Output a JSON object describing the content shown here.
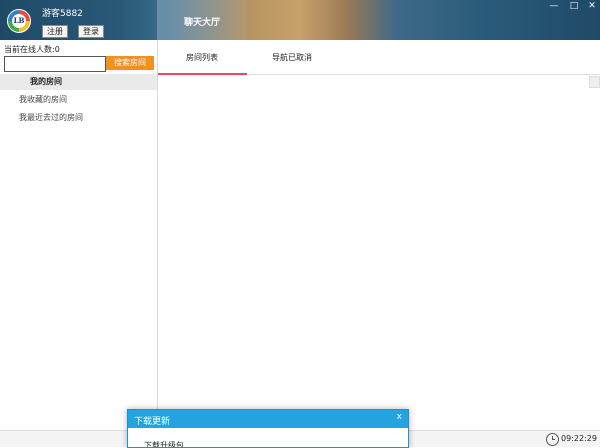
{
  "header": {
    "username": "游客5882",
    "register_label": "注册",
    "login_label": "登录",
    "title": "聊天大厅",
    "window_controls": [
      "—",
      "□",
      "✕"
    ]
  },
  "sidebar": {
    "online_count": "当前在线人数:0",
    "search_placeholder": "",
    "search_button": "搜索房间",
    "items": [
      {
        "label": "我的房间"
      },
      {
        "label": "我收藏的房间"
      },
      {
        "label": "我最近去过的房间"
      }
    ]
  },
  "tabs": [
    {
      "label": "房间列表"
    },
    {
      "label": "导航已取消"
    }
  ],
  "status": {
    "time": "09:22:29"
  },
  "dialog": {
    "title": "下载更新",
    "close": "x",
    "body": "下载升级包..."
  },
  "colors": {
    "accent_orange": "#f0921f",
    "tab_underline": "#e84a6a",
    "dialog_blue": "#25a3e0"
  }
}
